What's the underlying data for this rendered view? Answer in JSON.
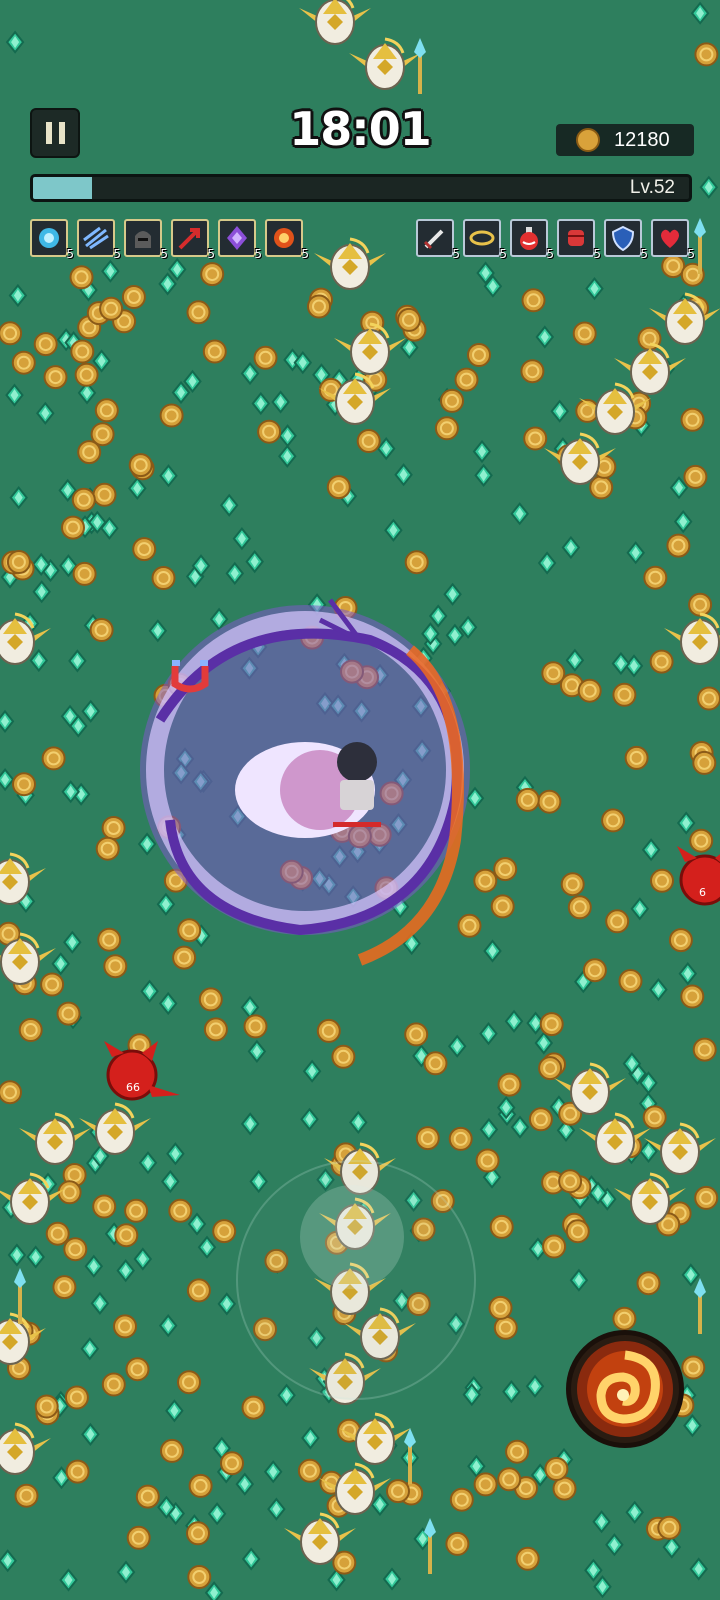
{
  "hud": {
    "timer": "18:01",
    "gold": "12180",
    "level": "Lv.52",
    "xp_progress": 0.09
  },
  "weapon_slots": [
    {
      "icon": "blue-orb-icon",
      "level": "5"
    },
    {
      "icon": "ice-shards-icon",
      "level": "5"
    },
    {
      "icon": "dark-helm-icon",
      "level": "5"
    },
    {
      "icon": "red-arrow-icon",
      "level": "5"
    },
    {
      "icon": "purple-crystal-icon",
      "level": "5"
    },
    {
      "icon": "fire-burst-icon",
      "level": "5"
    }
  ],
  "passive_slots": [
    {
      "icon": "sword-icon",
      "level": "5"
    },
    {
      "icon": "halo-icon",
      "level": "5"
    },
    {
      "icon": "potion-icon",
      "level": "5"
    },
    {
      "icon": "fist-icon",
      "level": "5"
    },
    {
      "icon": "shield-icon",
      "level": "5"
    },
    {
      "icon": "heart-icon",
      "level": "5"
    }
  ],
  "enemies": [
    {
      "kind": "red-demon",
      "hp_text": "66"
    },
    {
      "kind": "red-demon",
      "hp_text": "6"
    }
  ],
  "colors": {
    "grass": "#2e7f5e",
    "gem": "#35c79a",
    "coin": "#d9a23a",
    "vortex": "#8f5fd6",
    "fire": "#f06a1c"
  }
}
